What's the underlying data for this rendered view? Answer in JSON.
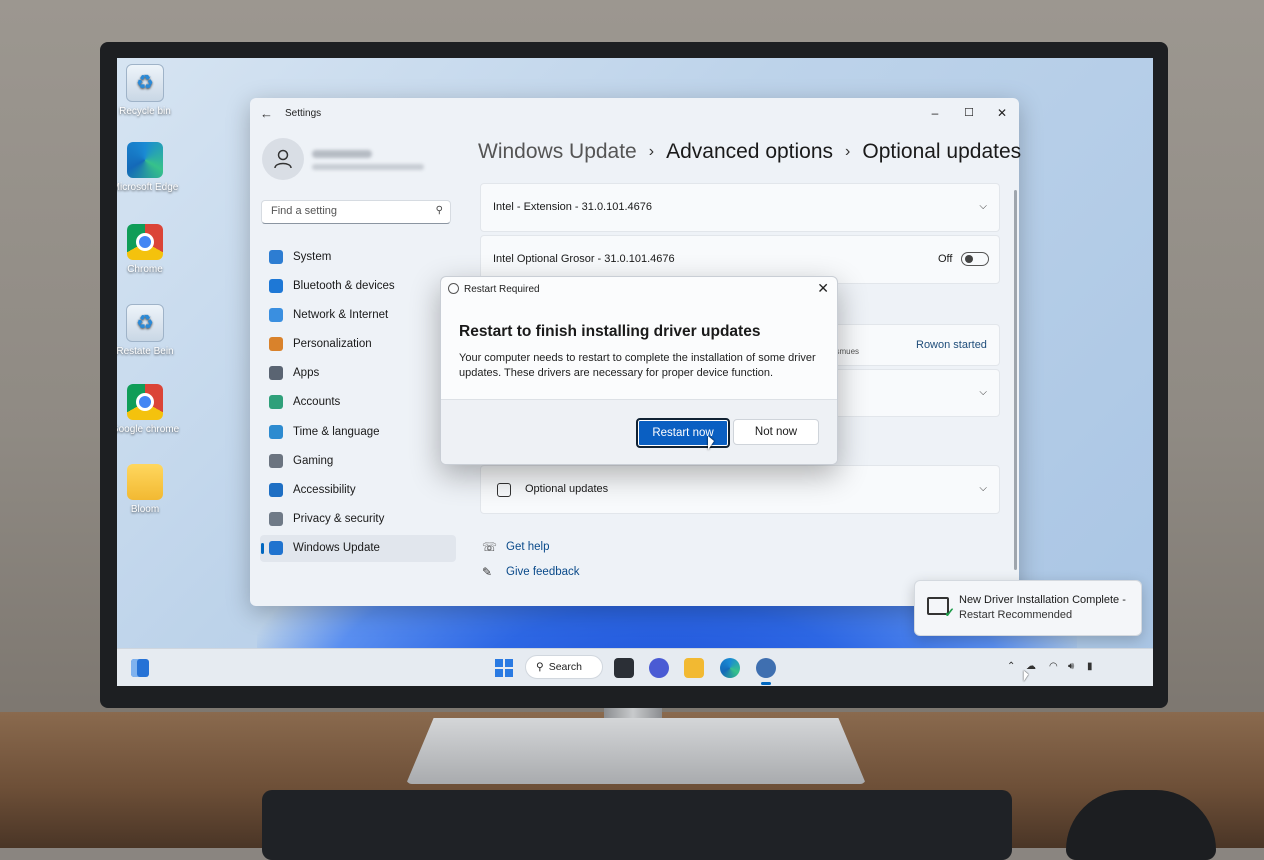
{
  "desktop": {
    "icons": [
      {
        "label": "Recycle bin"
      },
      {
        "label": "Microsoft Edge"
      },
      {
        "label": "Chrome"
      },
      {
        "label": "Restate Bein"
      },
      {
        "label": "Google chrome"
      },
      {
        "label": "Bloom"
      }
    ]
  },
  "settings": {
    "window_title": "Settings",
    "controls": {
      "minimize": "–",
      "maximize": "☐",
      "close": "✕"
    },
    "search_placeholder": "Find a setting",
    "nav": [
      {
        "label": "System",
        "color": "#2d7dd2"
      },
      {
        "label": "Bluetooth & devices",
        "color": "#1e78d6"
      },
      {
        "label": "Network & Internet",
        "color": "#3a8fe0"
      },
      {
        "label": "Personalization",
        "color": "#d9822b"
      },
      {
        "label": "Apps",
        "color": "#5a6472"
      },
      {
        "label": "Accounts",
        "color": "#2fa07a"
      },
      {
        "label": "Time & language",
        "color": "#2d8bd0"
      },
      {
        "label": "Gaming",
        "color": "#6b7480"
      },
      {
        "label": "Accessibility",
        "color": "#1e6fc4"
      },
      {
        "label": "Privacy & security",
        "color": "#6f7a87"
      },
      {
        "label": "Windows Update",
        "color": "#1f73cf",
        "active": true
      }
    ],
    "breadcrumb": {
      "part1": "Windows Update",
      "part2": "Advanced options",
      "part3": "Optional updates",
      "separator": "›"
    },
    "cards": {
      "card1": "Intel - Extension - 31.0.101.4676",
      "card2": "Intel  Optional Grosor - 31.0.101.4676",
      "card2_toggle": "Off",
      "card3_small": "usmues",
      "card3_status": "Rowon started",
      "optional_updates": "Optional updates"
    },
    "links": {
      "help": "Get help",
      "feedback": "Give feedback"
    }
  },
  "dialog": {
    "title": "Restart Required",
    "heading": "Restart to finish installing driver updates",
    "body": "Your computer needs to restart to complete the installation of some driver updates. These drivers are necessary for proper device function.",
    "primary": "Restart now",
    "secondary": "Not now"
  },
  "toast": {
    "title": "New Driver Installation Complete -",
    "subtitle": "Restart Recommended"
  },
  "taskbar": {
    "search_label": "Search"
  }
}
